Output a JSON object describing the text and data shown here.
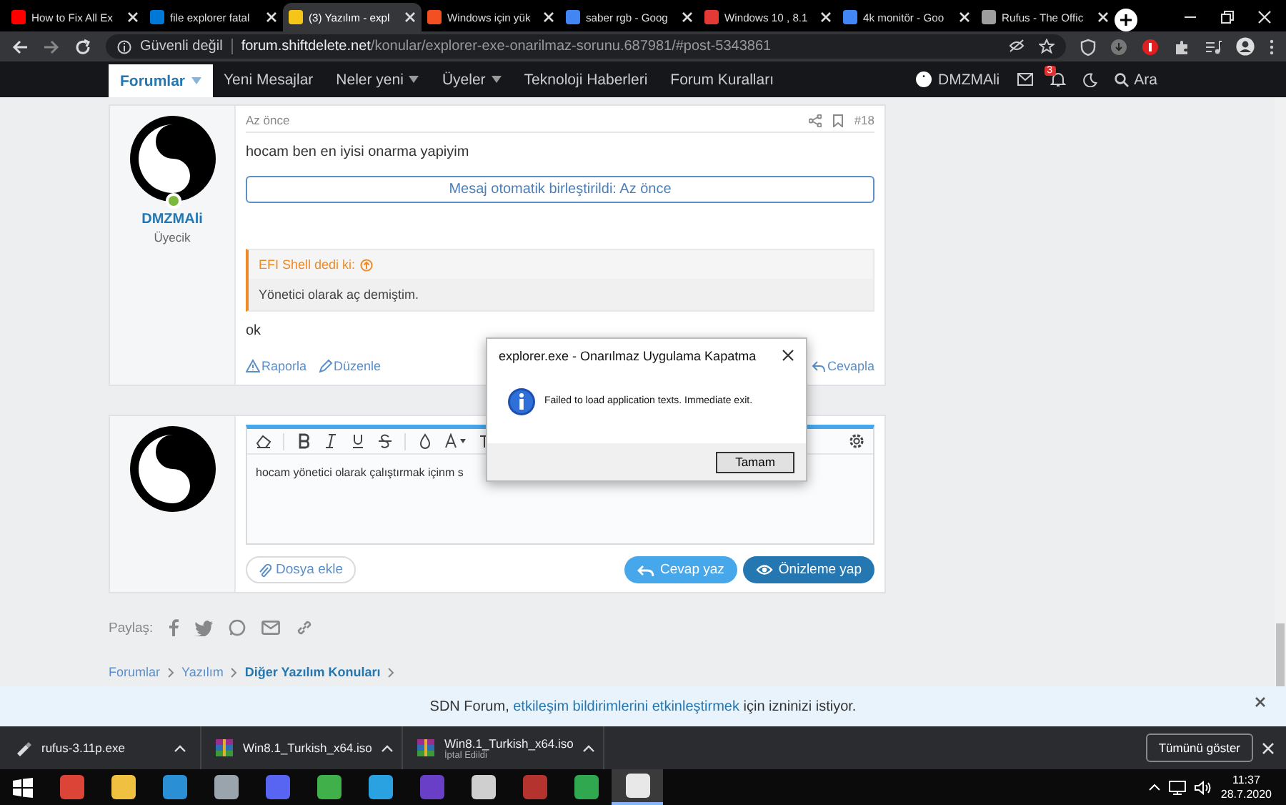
{
  "browser_tabs": [
    {
      "title": "How to Fix All Ex",
      "color": "#ff0000",
      "selected": false
    },
    {
      "title": "file explorer fatal",
      "color": "#0078d7",
      "selected": false
    },
    {
      "title": "(3) Yazılım - expl",
      "color": "#f5c518",
      "selected": true
    },
    {
      "title": "Windows için yük",
      "color": "#f25022",
      "selected": false
    },
    {
      "title": "saber rgb - Goog",
      "color": "#4285f4",
      "selected": false
    },
    {
      "title": "Windows 10 , 8.1",
      "color": "#e53935",
      "selected": false
    },
    {
      "title": "4k monitör - Goo",
      "color": "#4285f4",
      "selected": false
    },
    {
      "title": "Rufus - The Offic",
      "color": "#9e9e9e",
      "selected": false
    }
  ],
  "address_bar": {
    "security": "Güvenli değil",
    "url": "**forum.shiftdelete.net**/konular/explorer-exe-onarilmaz-sorunu.687981/#post-5343861"
  },
  "nav": {
    "items": [
      {
        "label": "Forumlar",
        "dropdown": true,
        "selected": true
      },
      {
        "label": "Yeni Mesajlar",
        "dropdown": false,
        "selected": false
      },
      {
        "label": "Neler yeni",
        "dropdown": true,
        "selected": false
      },
      {
        "label": "Üyeler",
        "dropdown": true,
        "selected": false
      },
      {
        "label": "Teknoloji Haberleri",
        "dropdown": false,
        "selected": false
      },
      {
        "label": "Forum Kuralları",
        "dropdown": false,
        "selected": false
      }
    ],
    "user": "DMZMAli",
    "alerts_badge": "3",
    "search": "Ara"
  },
  "post": {
    "user": "DMZMAli",
    "role": "Üyecik",
    "online": true,
    "time": "Az önce",
    "number": "#18",
    "body": "hocam ben en iyisi onarma yapiyim",
    "merged": "Mesaj otomatik birleştirildi: Az önce",
    "quote": {
      "author": "EFI Shell dedi ki:",
      "text": "Yönetici olarak aç demiştim."
    },
    "body2": "ok",
    "actions": [
      "Raporla",
      "Düzenle"
    ],
    "reply": "Cevapla"
  },
  "reply_editor": {
    "text": "hocam yönetici olarak çalıştırmak içinm s",
    "attach": "Dosya ekle",
    "submit": "Cevap yaz",
    "preview": "Önizleme yap"
  },
  "share": {
    "label": "Paylaş:"
  },
  "breadcrumb": [
    {
      "label": "Forumlar",
      "current": false
    },
    {
      "label": "Yazılım",
      "current": false
    },
    {
      "label": "Diğer Yazılım Konuları",
      "current": true
    }
  ],
  "notice": {
    "before": "SDN Forum, ",
    "link": "etkileşim bildirimlerini etkinleştirmek",
    "after": " için izninizi istiyor."
  },
  "dialog": {
    "title": "explorer.exe - Onarılmaz Uygulama Kapatma",
    "message": "Failed to load application texts. Immediate exit.",
    "button": "Tamam"
  },
  "downloads": {
    "items": [
      {
        "name": "rufus-3.11p.exe",
        "kind": "exe"
      },
      {
        "name": "Win8.1_Turkish_x64.iso",
        "kind": "archive"
      },
      {
        "name": "Win8.1_Turkish_x64.iso",
        "kind": "archive",
        "status": "İptal Edildi"
      }
    ],
    "show_all": "Tümünü göster"
  },
  "taskbar": {
    "apps": [
      {
        "color": "#db4437",
        "selected": false
      },
      {
        "color": "#f0c040",
        "selected": false
      },
      {
        "color": "#2b8fd6",
        "selected": false
      },
      {
        "color": "#9aa4ad",
        "selected": false
      },
      {
        "color": "#5865f2",
        "selected": false
      },
      {
        "color": "#3fb04a",
        "selected": false
      },
      {
        "color": "#2aa1e0",
        "selected": false
      },
      {
        "color": "#6a3fc8",
        "selected": false
      },
      {
        "color": "#cfcfcf",
        "selected": false
      },
      {
        "color": "#b5332e",
        "selected": false
      },
      {
        "color": "#2fa84f",
        "selected": false
      },
      {
        "color": "#e8e8e8",
        "selected": true
      }
    ],
    "time": "11:37",
    "date": "28.7.2020"
  }
}
